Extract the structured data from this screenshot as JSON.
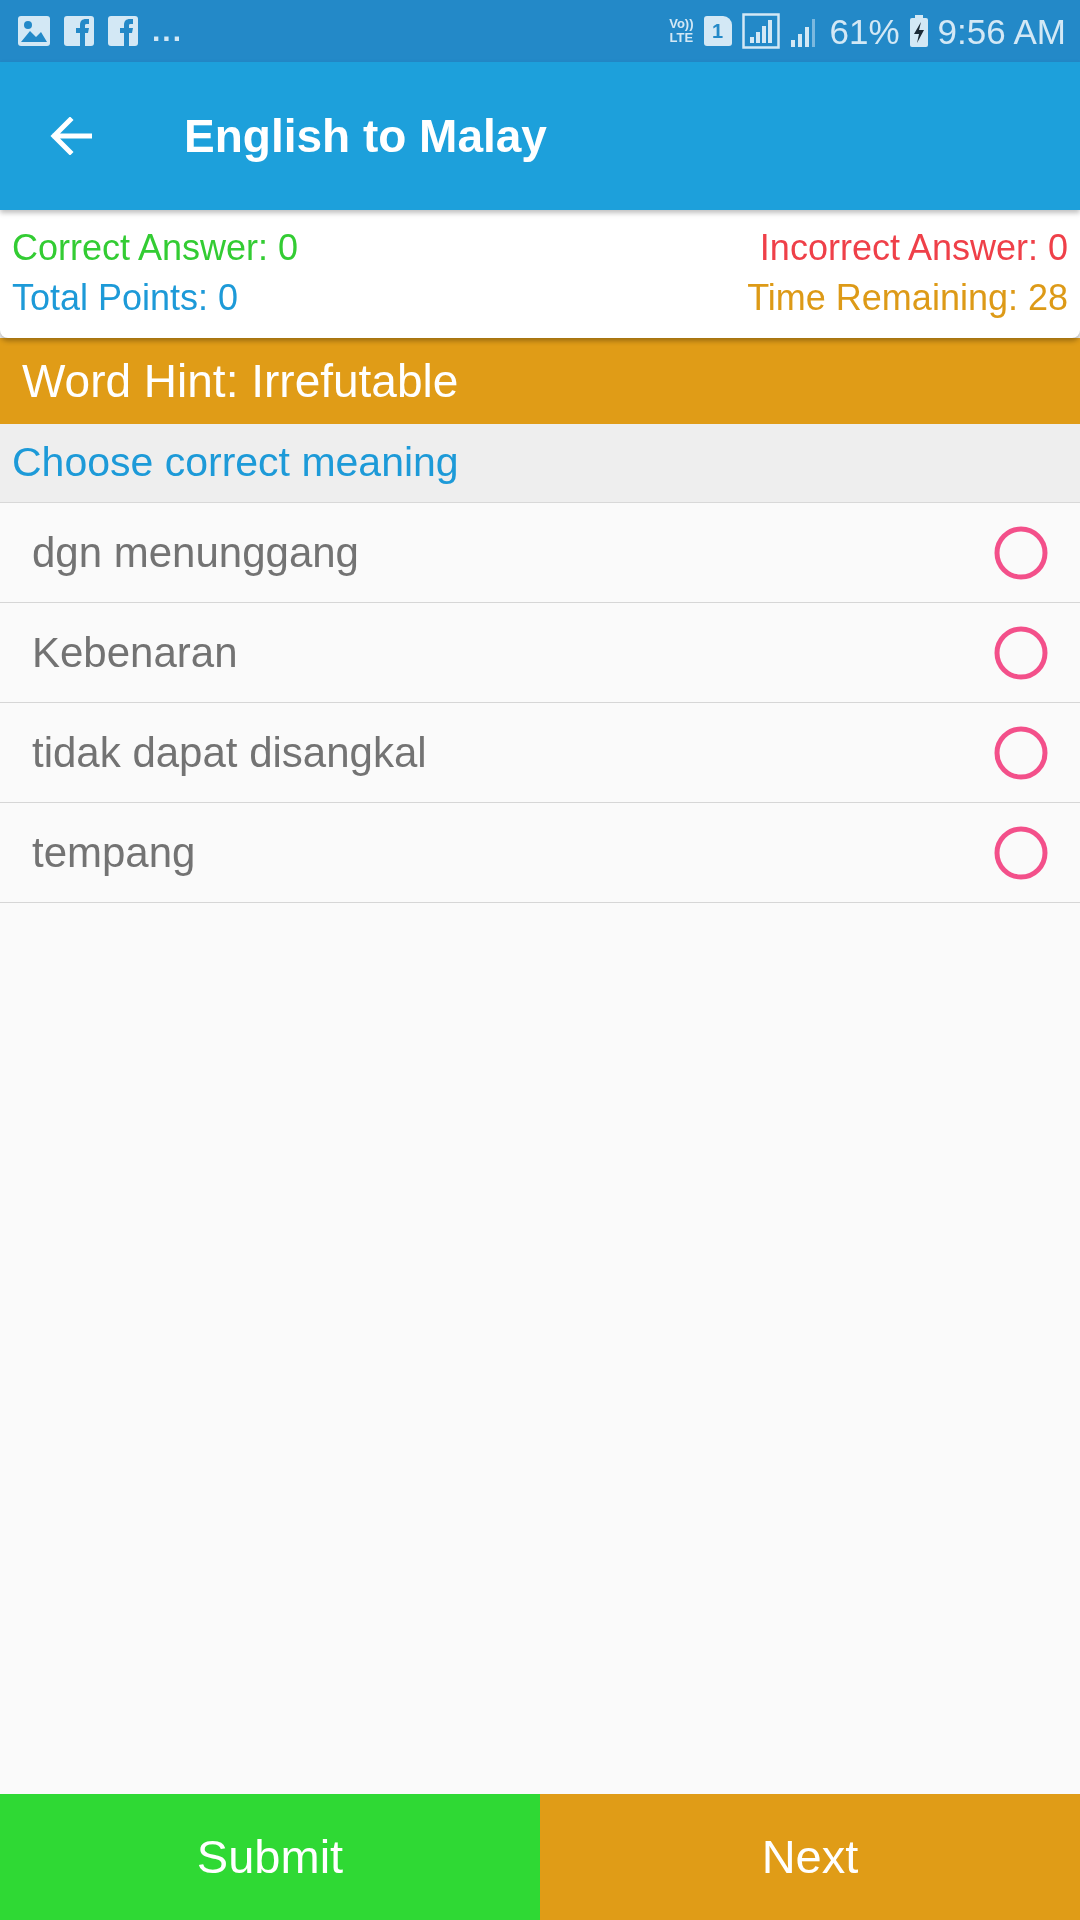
{
  "status_bar": {
    "more": "...",
    "volte_lines": [
      "Vo))",
      "LTE"
    ],
    "sim_label": "1",
    "battery": "61%",
    "time": "9:56 AM"
  },
  "app_bar": {
    "title": "English to Malay"
  },
  "stats": [
    {
      "kind": "correct",
      "text": "Correct Answer: 0"
    },
    {
      "kind": "incorrect",
      "text": "Incorrect Answer: 0"
    },
    {
      "kind": "points",
      "text": "Total Points: 0"
    },
    {
      "kind": "time",
      "text": "Time Remaining: 28"
    }
  ],
  "word_hint": "Word Hint: Irrefutable",
  "prompt": "Choose correct meaning",
  "options": [
    {
      "label": "dgn menunggang",
      "selected": false
    },
    {
      "label": "Kebenaran",
      "selected": false
    },
    {
      "label": "tidak dapat disangkal",
      "selected": false
    },
    {
      "label": "tempang",
      "selected": false
    }
  ],
  "buttons": [
    {
      "kind": "submit",
      "label": "Submit"
    },
    {
      "kind": "next",
      "label": "Next"
    }
  ]
}
